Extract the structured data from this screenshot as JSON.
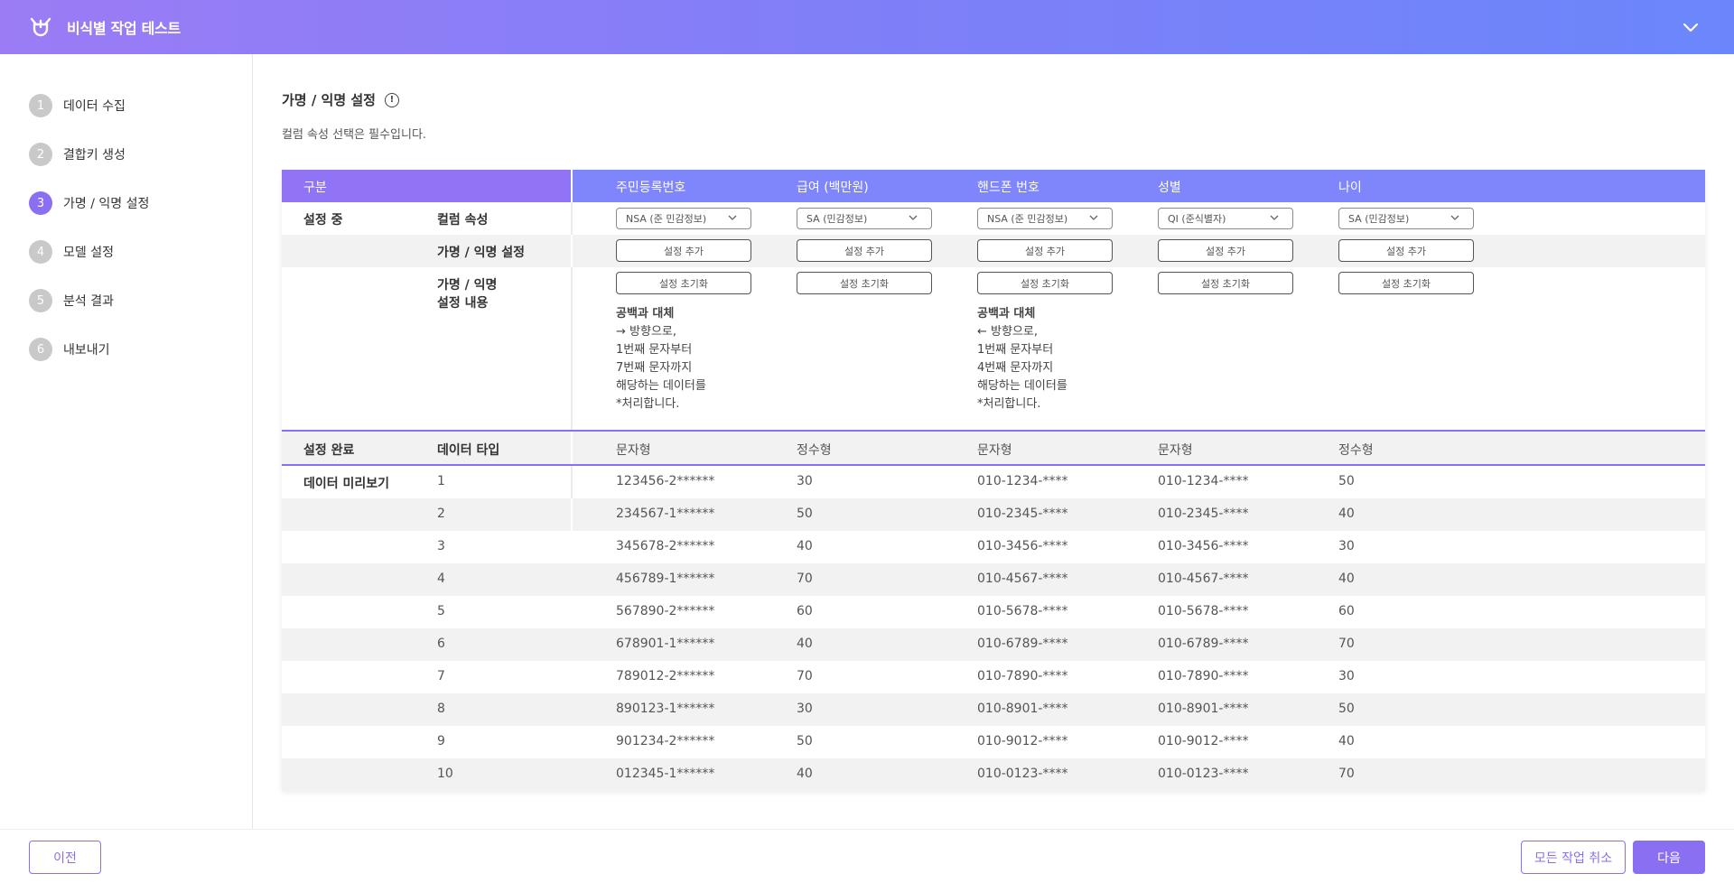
{
  "app": {
    "title": "비식별 작업 테스트"
  },
  "steps": [
    {
      "num": "1",
      "label": "데이터 수집"
    },
    {
      "num": "2",
      "label": "결합키 생성"
    },
    {
      "num": "3",
      "label": "가명 / 익명 설정"
    },
    {
      "num": "4",
      "label": "모델 설정"
    },
    {
      "num": "5",
      "label": "분석 결과"
    },
    {
      "num": "6",
      "label": "내보내기"
    }
  ],
  "section": {
    "title": "가명 / 익명 설정",
    "subtitle": "컬럼 속성 선택은 필수입니다."
  },
  "table": {
    "header_label": "구분",
    "columns": [
      "주민등록번호",
      "급여 (백만원)",
      "핸드폰 번호",
      "성별",
      "나이"
    ],
    "setting_label": "설정 중",
    "attr_label": "컬럼 속성",
    "attr_values": [
      "NSA (준 민감정보)",
      "SA (민감정보)",
      "NSA (준 민감정보)",
      "QI (준식별자)",
      "SA (민감정보)"
    ],
    "pseudo_label": "가명 / 익명 설정",
    "add_button": "설정 추가",
    "content_label_1": "가명 / 익명",
    "content_label_2": "설정 내용",
    "reset_button": "설정 초기화",
    "desc_col1": {
      "title": "공백과 대체",
      "lines": [
        "→ 방향으로,",
        "1번째 문자부터",
        "7번째 문자까지",
        "해당하는 데이터를",
        "*처리합니다."
      ]
    },
    "desc_col3": {
      "title": "공백과 대체",
      "lines": [
        "← 방향으로,",
        "1번째 문자부터",
        "4번째 문자까지",
        "해당하는 데이터를",
        "*처리합니다."
      ]
    },
    "done_label": "설정 완료",
    "type_label": "데이터 타입",
    "types": [
      "문자형",
      "정수형",
      "문자형",
      "문자형",
      "정수형"
    ],
    "preview_label": "데이터 미리보기",
    "rows": [
      [
        "1",
        "123456-2******",
        "30",
        "010-1234-****",
        "010-1234-****",
        "50"
      ],
      [
        "2",
        "234567-1******",
        "50",
        "010-2345-****",
        "010-2345-****",
        "40"
      ],
      [
        "3",
        "345678-2******",
        "40",
        "010-3456-****",
        "010-3456-****",
        "30"
      ],
      [
        "4",
        "456789-1******",
        "70",
        "010-4567-****",
        "010-4567-****",
        "40"
      ],
      [
        "5",
        "567890-2******",
        "60",
        "010-5678-****",
        "010-5678-****",
        "60"
      ],
      [
        "6",
        "678901-1******",
        "40",
        "010-6789-****",
        "010-6789-****",
        "70"
      ],
      [
        "7",
        "789012-2******",
        "70",
        "010-7890-****",
        "010-7890-****",
        "30"
      ],
      [
        "8",
        "890123-1******",
        "30",
        "010-8901-****",
        "010-8901-****",
        "50"
      ],
      [
        "9",
        "901234-2******",
        "50",
        "010-9012-****",
        "010-9012-****",
        "40"
      ],
      [
        "10",
        "012345-1******",
        "40",
        "010-0123-****",
        "010-0123-****",
        "70"
      ]
    ]
  },
  "footer": {
    "prev": "이전",
    "cancel": "모든 작업 취소",
    "next": "다음"
  },
  "colors": {
    "accent": "#8a6ff3",
    "header_start": "#9b7cf5",
    "header_end": "#6b86fb"
  }
}
